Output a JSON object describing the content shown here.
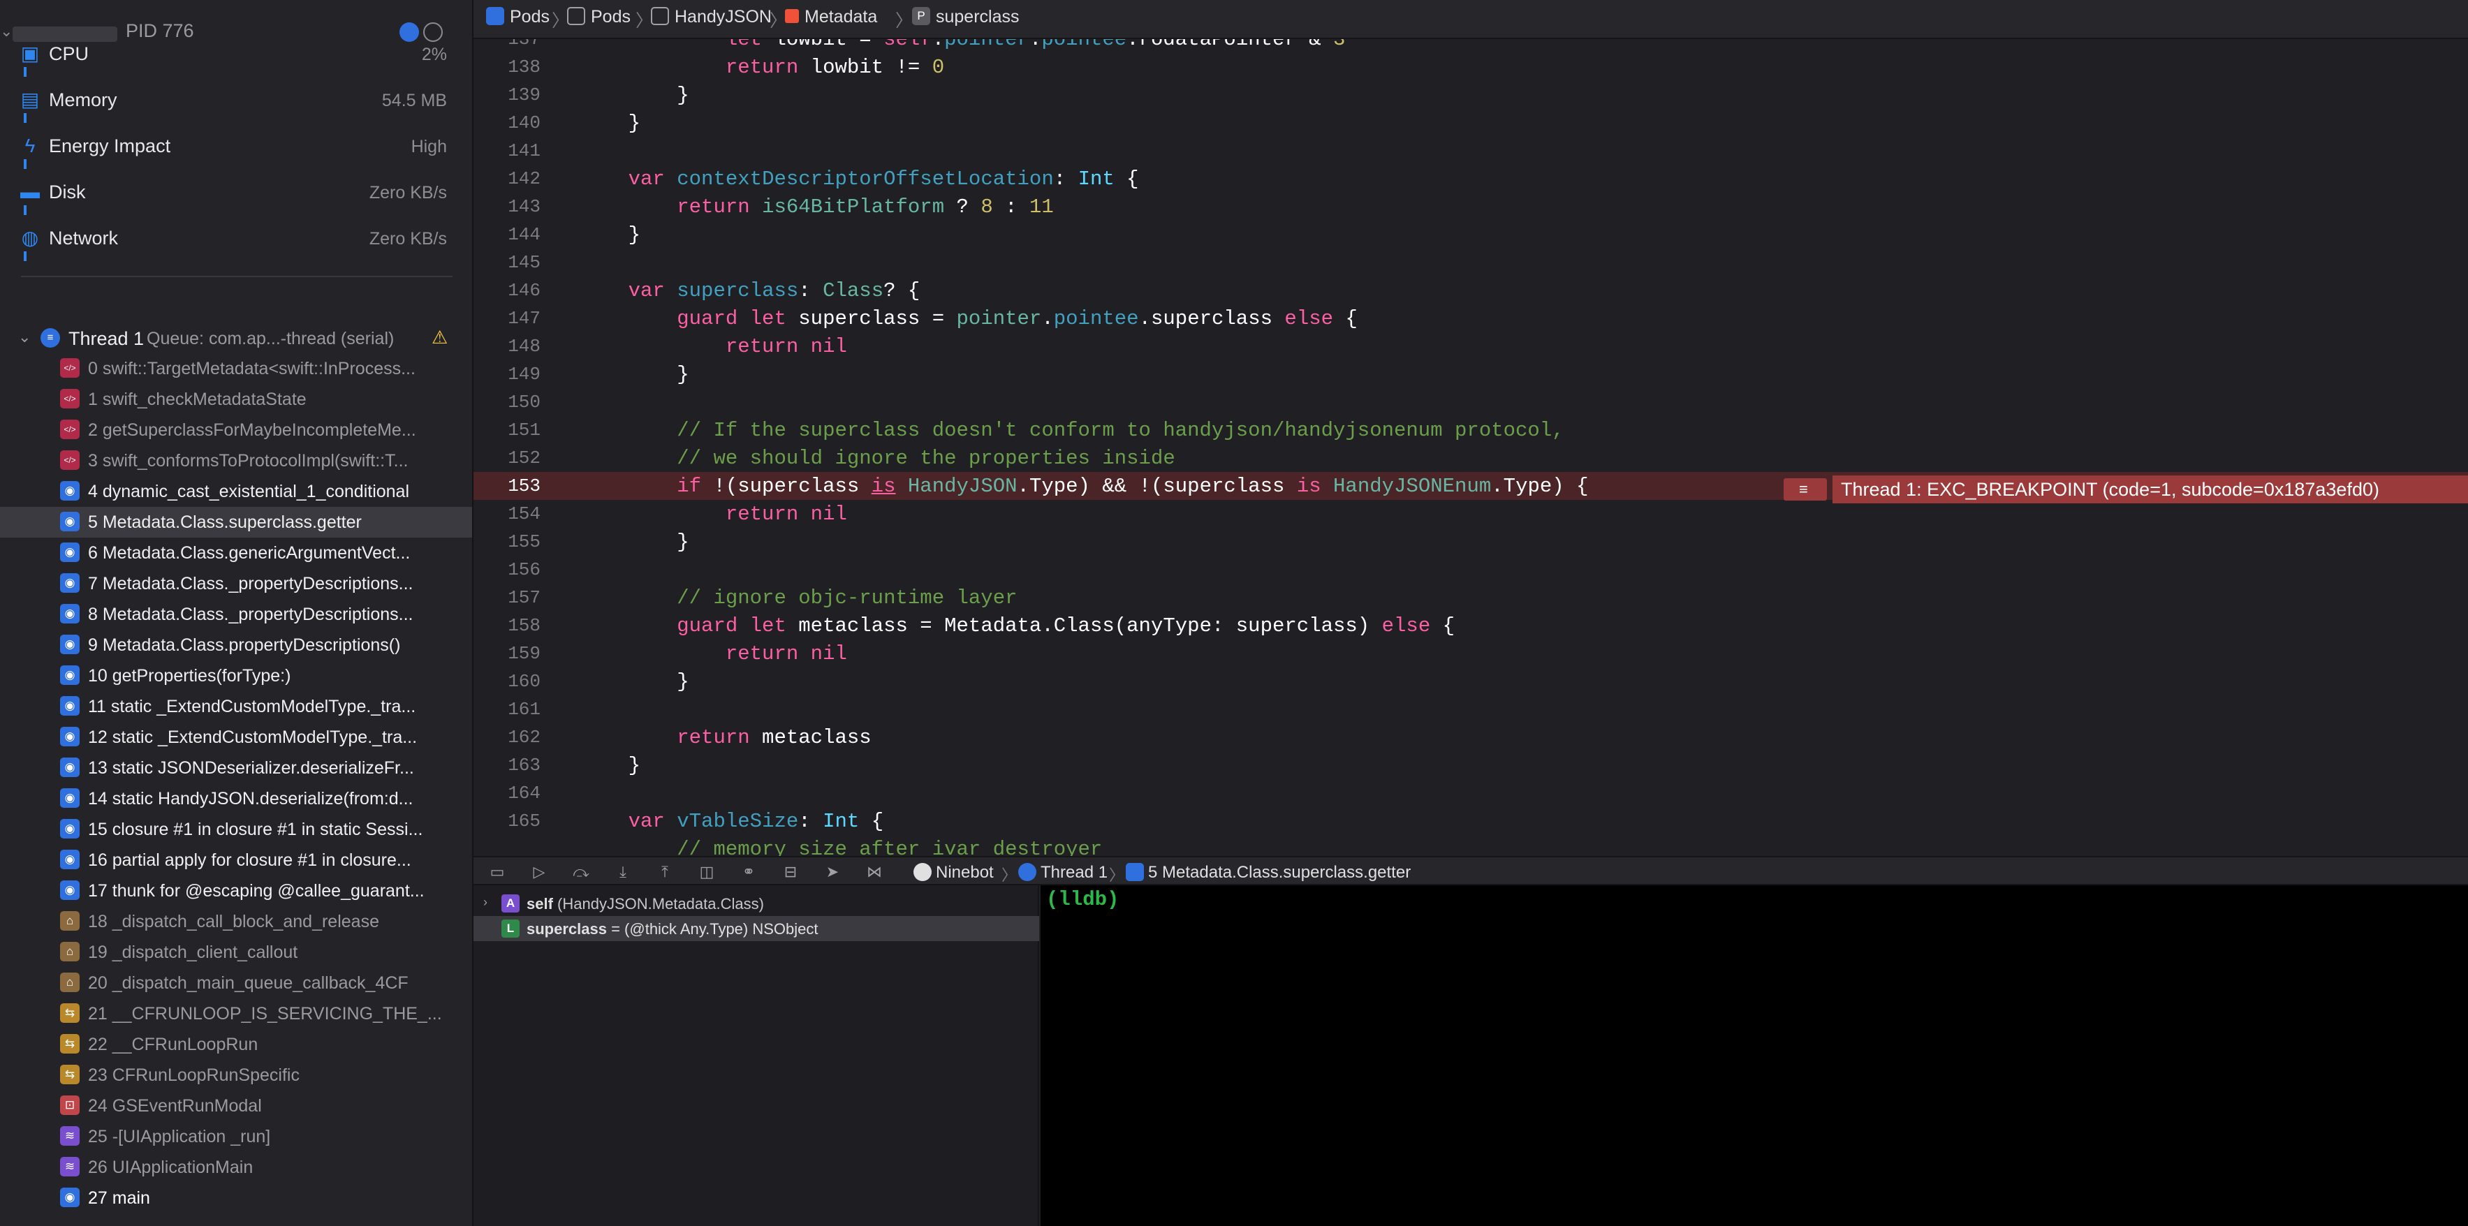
{
  "process": {
    "pid_label": "PID 776"
  },
  "gauges": [
    {
      "label": "CPU",
      "value": "2%",
      "icon": "cpu-icon"
    },
    {
      "label": "Memory",
      "value": "54.5 MB",
      "icon": "memory-icon"
    },
    {
      "label": "Energy Impact",
      "value": "High",
      "icon": "energy-icon"
    },
    {
      "label": "Disk",
      "value": "Zero KB/s",
      "icon": "disk-icon"
    },
    {
      "label": "Network",
      "value": "Zero KB/s",
      "icon": "network-icon"
    }
  ],
  "thread": {
    "name": "Thread 1",
    "queue": "Queue: com.ap...-thread (serial)"
  },
  "frames": [
    {
      "text": "0 swift::TargetMetadata<swift::InProcess...",
      "kind": "sys"
    },
    {
      "text": "1 swift_checkMetadataState",
      "kind": "sys"
    },
    {
      "text": "2 getSuperclassForMaybeIncompleteMe...",
      "kind": "sys"
    },
    {
      "text": "3 swift_conformsToProtocolImpl(swift::T...",
      "kind": "sys"
    },
    {
      "text": "4 dynamic_cast_existential_1_conditional",
      "kind": "user"
    },
    {
      "text": "5 Metadata.Class.superclass.getter",
      "kind": "user"
    },
    {
      "text": "6 Metadata.Class.genericArgumentVect...",
      "kind": "user"
    },
    {
      "text": "7 Metadata.Class._propertyDescriptions...",
      "kind": "user"
    },
    {
      "text": "8 Metadata.Class._propertyDescriptions...",
      "kind": "user"
    },
    {
      "text": "9 Metadata.Class.propertyDescriptions()",
      "kind": "user"
    },
    {
      "text": "10 getProperties(forType:)",
      "kind": "user"
    },
    {
      "text": "11 static _ExtendCustomModelType._tra...",
      "kind": "user"
    },
    {
      "text": "12 static _ExtendCustomModelType._tra...",
      "kind": "user"
    },
    {
      "text": "13 static JSONDeserializer.deserializeFr...",
      "kind": "user"
    },
    {
      "text": "14 static HandyJSON.deserialize(from:d...",
      "kind": "user"
    },
    {
      "text": "15 closure #1 in closure #1 in static Sessi...",
      "kind": "user"
    },
    {
      "text": "16 partial apply for closure #1 in closure...",
      "kind": "user"
    },
    {
      "text": "17 thunk for @escaping @callee_guarant...",
      "kind": "user"
    },
    {
      "text": "18 _dispatch_call_block_and_release",
      "kind": "lib"
    },
    {
      "text": "19 _dispatch_client_callout",
      "kind": "lib"
    },
    {
      "text": "20 _dispatch_main_queue_callback_4CF",
      "kind": "lib"
    },
    {
      "text": "21 __CFRUNLOOP_IS_SERVICING_THE_...",
      "kind": "fw"
    },
    {
      "text": "22 __CFRunLoopRun",
      "kind": "fw"
    },
    {
      "text": "23 CFRunLoopRunSpecific",
      "kind": "fw"
    },
    {
      "text": "24 GSEventRunModal",
      "kind": "gs"
    },
    {
      "text": "25 -[UIApplication _run]",
      "kind": "ui"
    },
    {
      "text": "26 UIApplicationMain",
      "kind": "ui"
    },
    {
      "text": "27 main",
      "kind": "user"
    }
  ],
  "breadcrumb": [
    "Pods",
    "Pods",
    "HandyJSON",
    "Metadata",
    "superclass"
  ],
  "breakpoint": {
    "message": "Thread 1: EXC_BREAKPOINT (code=1, subcode=0x187a3efd0)"
  },
  "debug_crumbs": [
    "Ninebot",
    "Thread 1",
    "5 Metadata.Class.superclass.getter"
  ],
  "variables": [
    {
      "badge": "A",
      "name": "self",
      "detail": " (HandyJSON.Metadata.Class)"
    },
    {
      "badge": "L",
      "name": "superclass",
      "detail": " = (@thick Any.Type) NSObject"
    }
  ],
  "console": {
    "prompt": "(lldb)"
  },
  "colors": {
    "accent": "#2f86f0",
    "error": "#9b3a3a",
    "prompt": "#2fb84a"
  }
}
